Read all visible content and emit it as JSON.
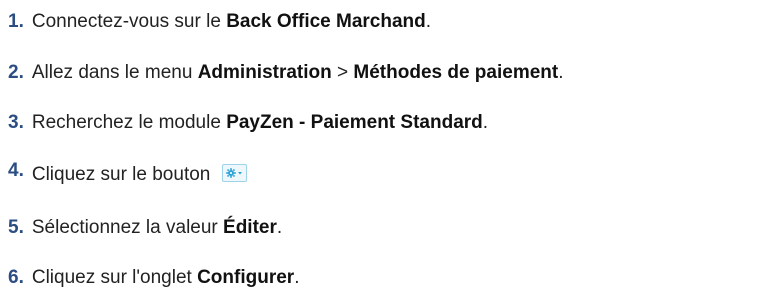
{
  "steps": [
    {
      "number": "1.",
      "text_before": "Connectez-vous sur le ",
      "bold": "Back Office Marchand",
      "text_after": "."
    },
    {
      "number": "2.",
      "text_before": "Allez dans le menu ",
      "bold": "Administration",
      "text_middle": " > ",
      "bold2": "Méthodes de paiement",
      "text_after": "."
    },
    {
      "number": "3.",
      "text_before": "Recherchez le module ",
      "bold": "PayZen - Paiement Standard",
      "text_after": "."
    },
    {
      "number": "4.",
      "text_before": "Cliquez sur le bouton ",
      "button_icon": "gear-dropdown-icon"
    },
    {
      "number": "5.",
      "text_before": "Sélectionnez la valeur ",
      "bold": "Éditer",
      "text_after": "."
    },
    {
      "number": "6.",
      "text_before": "Cliquez sur l'onglet ",
      "bold": "Configurer",
      "text_after": "."
    }
  ],
  "colors": {
    "step_number": "#2b4d82",
    "text": "#222222",
    "button_border": "#9fd3e8",
    "button_bg": "#eef8fc",
    "button_icon": "#29a3d6"
  }
}
